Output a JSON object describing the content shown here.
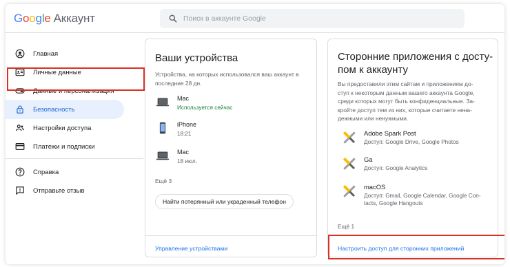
{
  "header": {
    "logo_letters": [
      "G",
      "o",
      "o",
      "g",
      "l",
      "e"
    ],
    "account_label": "Аккаунт",
    "search_placeholder": "Поиск в аккаунте Google"
  },
  "sidebar": {
    "items": [
      {
        "label": "Главная",
        "icon": "person-circle-icon"
      },
      {
        "label": "Личные данные",
        "icon": "id-card-icon"
      },
      {
        "label": "Данные и персонализация",
        "icon": "toggle-icon"
      },
      {
        "label": "Безопасность",
        "icon": "lock-icon",
        "active": true
      },
      {
        "label": "Настройки доступа",
        "icon": "people-icon"
      },
      {
        "label": "Платежи и подписки",
        "icon": "credit-card-icon"
      },
      {
        "label": "Справка",
        "icon": "help-circle-icon"
      },
      {
        "label": "Отправьте отзыв",
        "icon": "feedback-icon"
      }
    ]
  },
  "devices_card": {
    "title": "Ваши устройства",
    "description": "Устройства, на которых использовался ваш аккаунт в последние 28 дн.",
    "devices": [
      {
        "name": "Mac",
        "status": "Используется сейчас",
        "icon": "laptop-icon"
      },
      {
        "name": "iPhone",
        "status": "18:21",
        "icon": "phone-icon"
      },
      {
        "name": "Mac",
        "status": "18 июл.",
        "icon": "laptop-icon"
      }
    ],
    "more": "Ещё 3",
    "find_phone_button": "Найти потерянный или украденный телефон",
    "manage_link": "Управление устройствами"
  },
  "apps_card": {
    "title_line1": "Сторонние приложения с досту-",
    "title_line2": "пом к аккаунту",
    "description_lines": [
      "Вы предоставили этим сайтам и приложениям до-",
      "ступ к некоторым данным вашего аккаунта Google,",
      "среди которых могут быть конфиденциальные. За-",
      "кройте доступ тем из них, которые считаете нена-",
      "дежными или ненужными."
    ],
    "apps": [
      {
        "name": "Adobe Spark Post",
        "access": [
          "Доступ: Google Drive, Google Photos"
        ],
        "icon": "tools-icon"
      },
      {
        "name": "Ga",
        "access": [
          "Доступ: Google Analytics"
        ],
        "icon": "tools-icon"
      },
      {
        "name": "macOS",
        "access": [
          "Доступ: Gmail, Google Calendar, Google Con-",
          "tacts, Google Hangouts"
        ],
        "icon": "tools-icon"
      }
    ],
    "more": "Ещё 1",
    "configure_link": "Настроить доступ для сторонних приложений"
  },
  "colors": {
    "highlight": "#d93025",
    "link": "#1a73e8",
    "active_bg": "#e8f0fe",
    "active_text": "#1967d2",
    "status_green": "#188038"
  }
}
